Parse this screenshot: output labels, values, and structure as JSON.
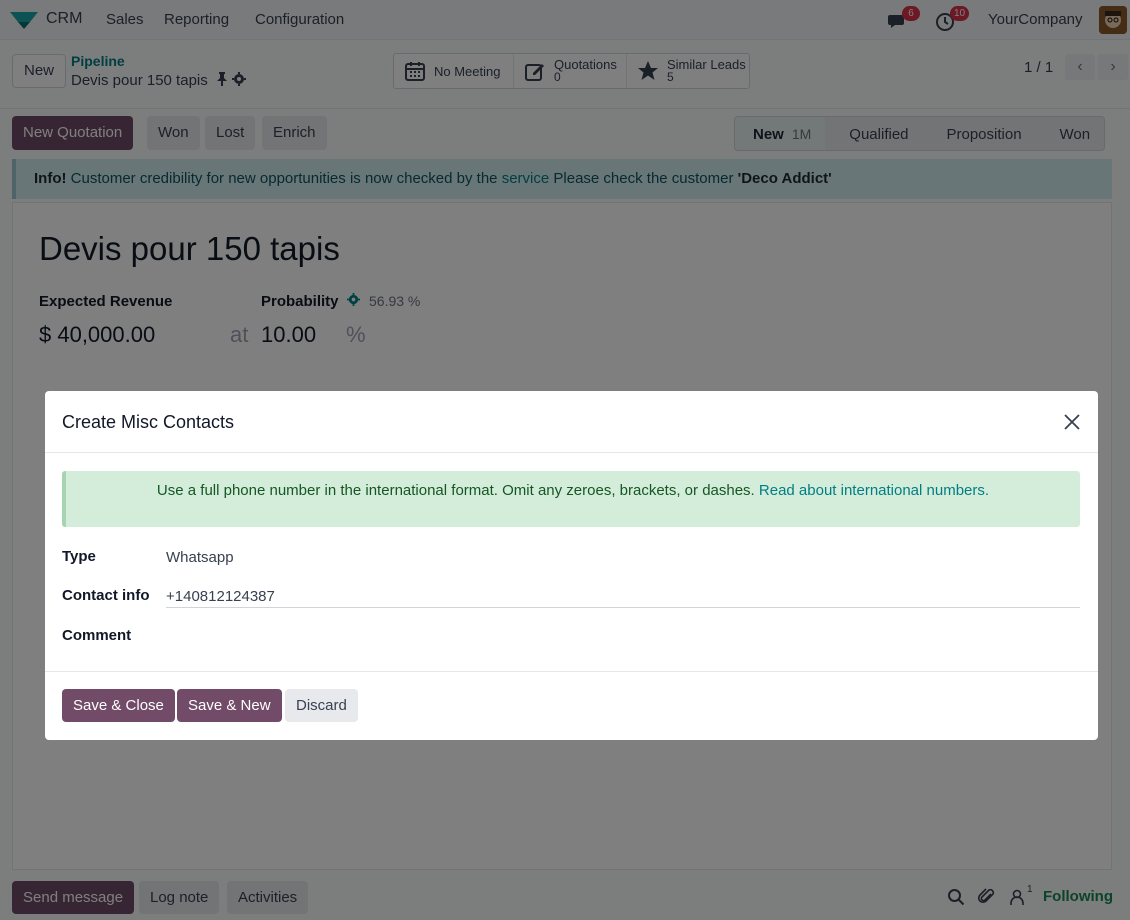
{
  "navbar": {
    "app_name": "CRM",
    "menu": [
      "Sales",
      "Reporting",
      "Configuration"
    ],
    "messages_badge": "6",
    "activities_badge": "10",
    "company": "YourCompany"
  },
  "control_panel": {
    "new_label": "New",
    "breadcrumb": "Pipeline",
    "record_name": "Devis pour 150 tapis",
    "smart_buttons": [
      {
        "label": "No Meeting",
        "value": "",
        "icon": "calendar-icon"
      },
      {
        "label": "Quotations",
        "value": "0",
        "icon": "edit-icon"
      },
      {
        "label": "Similar Leads",
        "value": "5",
        "icon": "star-icon"
      }
    ],
    "pager": "1 / 1"
  },
  "actions": {
    "new_quotation": "New Quotation",
    "won": "Won",
    "lost": "Lost",
    "enrich": "Enrich"
  },
  "stages": [
    {
      "name": "New",
      "duration": "1M",
      "current": true
    },
    {
      "name": "Qualified"
    },
    {
      "name": "Proposition"
    },
    {
      "name": "Won"
    }
  ],
  "info_banner": {
    "prefix": "Info!",
    "text": " Customer credibility for new opportunities is now checked by the ",
    "link": "service",
    "text2": " Please check the customer ",
    "customer": "'Deco Addict'"
  },
  "form": {
    "title": "Devis pour 150 tapis",
    "expected_revenue_label": "Expected Revenue",
    "expected_revenue": "$ 40,000.00",
    "at": "at",
    "probability_label": "Probability",
    "probability": "10.00",
    "percent": "%",
    "automated_probability": "56.93 %"
  },
  "modal": {
    "title": "Create Misc Contacts",
    "hint_text": "Use a full phone number in the international format. Omit any zeroes, brackets, or dashes. ",
    "hint_link": "Read about international numbers.",
    "type_label": "Type",
    "type_value": "Whatsapp",
    "contact_label": "Contact info",
    "contact_value": "+140812124387",
    "comment_label": "Comment",
    "save_close": "Save & Close",
    "save_new": "Save & New",
    "discard": "Discard"
  },
  "chatter": {
    "send_message": "Send message",
    "log_note": "Log note",
    "activities": "Activities",
    "followers_count": "1",
    "following": "Following"
  },
  "colors": {
    "primary": "#714b67",
    "link": "#017e84",
    "info_bg": "#d1ecf1",
    "success_bg": "#d4edda"
  }
}
